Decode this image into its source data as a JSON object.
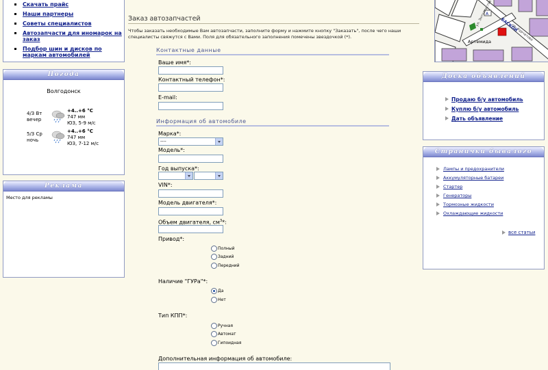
{
  "left_nav": {
    "items": [
      {
        "label": "Скачать прайс"
      },
      {
        "label": "Наши партнеры"
      },
      {
        "label": "Советы специалистов"
      },
      {
        "label": "Автозапчасти для иномарок на заказ"
      },
      {
        "label": "Подбор шин и дисков по маркам автомобилей"
      }
    ]
  },
  "weather": {
    "title": "Погода",
    "city": "Волгодонск",
    "rows": [
      {
        "date": "4/3 Вт",
        "time": "вечер",
        "temp": "+4..+6 °C",
        "pressure": "747 мм",
        "wind": "ЮЗ, 5-9 м/с"
      },
      {
        "date": "5/3 Ср",
        "time": "ночь",
        "temp": "+4..+6 °C",
        "pressure": "747 мм",
        "wind": "ЮЗ, 7-12 м/с"
      }
    ]
  },
  "ads": {
    "title": "Реклама",
    "text": "Место для рекламы"
  },
  "form": {
    "title": "Заказ автозапчастей",
    "intro": "Чтобы заказать необходимые Вам автозапчасти, заполните форму и нажмите кнопку \"Заказать\", после чего наши специалисты свяжутся с Вами. Поля для обязательного заполнения помечены звездочкой (*).",
    "contact_section": "Контактные данные",
    "name_label": "Ваше имя*:",
    "phone_label": "Контактный телефон*:",
    "email_label": "E-mail:",
    "car_section": "Информация об автомобиле",
    "brand_label": "Марка*:",
    "brand_value": "----",
    "model_label": "Модель*:",
    "year_label": "Год выпуска*:",
    "vin_label": "VIN*:",
    "engine_model_label": "Модель двигателя*:",
    "engine_volume_label": "Объем двигателя, см",
    "engine_volume_sup": "3",
    "engine_volume_tail": "*:",
    "drive_label": "Привод*:",
    "drive_options": [
      "Полный",
      "Задний",
      "Передний"
    ],
    "gur_label": "Наличие \"ГУРа\"*:",
    "gur_options": [
      "Да",
      "Нет"
    ],
    "gearbox_label": "Тип КПП*:",
    "gearbox_options": [
      "Ручная",
      "Автомат",
      "Гипоидная"
    ],
    "extra_label": "Дополнительная информация об автомобиле:"
  },
  "map": {
    "labels": [
      "Артемида",
      "БАСКОЙ",
      "пр. Курчатова",
      "ул. Энтузиастов",
      "А"
    ]
  },
  "board": {
    "title": "Доска объявлений",
    "links": [
      "Продаю б/у автомобиль",
      "Куплю б/у автомобиль",
      "Дать объявление"
    ]
  },
  "tips": {
    "title": "Странички бывалого",
    "links": [
      "Лампы и предохранители",
      "Аккумуляторные батареи",
      "Стартер",
      "Генераторы",
      "Тормозные жидкости",
      "Охлаждающие жидкости"
    ],
    "all": "все статьи"
  }
}
